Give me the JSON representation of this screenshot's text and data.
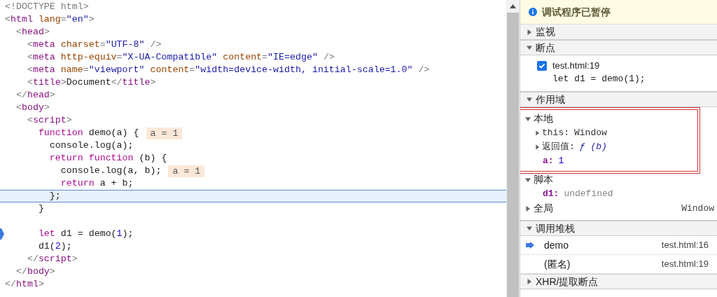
{
  "editor": {
    "lines": [
      {
        "tokens": [
          {
            "kind": "punct",
            "text": "<!DOCTYPE html>"
          }
        ]
      },
      {
        "tokens": [
          {
            "kind": "punct",
            "text": "<"
          },
          {
            "kind": "tag",
            "text": "html"
          },
          {
            "kind": "attr",
            "text": " lang"
          },
          {
            "kind": "punct",
            "text": "="
          },
          {
            "kind": "value",
            "text": "\"en\""
          },
          {
            "kind": "punct",
            "text": ">"
          }
        ]
      },
      {
        "tokens": [
          {
            "kind": "punct",
            "text": "  <"
          },
          {
            "kind": "tag",
            "text": "head"
          },
          {
            "kind": "punct",
            "text": ">"
          }
        ]
      },
      {
        "tokens": [
          {
            "kind": "punct",
            "text": "    <"
          },
          {
            "kind": "tag",
            "text": "meta"
          },
          {
            "kind": "attr",
            "text": " charset"
          },
          {
            "kind": "punct",
            "text": "="
          },
          {
            "kind": "value",
            "text": "\"UTF-8\""
          },
          {
            "kind": "punct",
            "text": " />"
          }
        ]
      },
      {
        "tokens": [
          {
            "kind": "punct",
            "text": "    <"
          },
          {
            "kind": "tag",
            "text": "meta"
          },
          {
            "kind": "attr",
            "text": " http-equiv"
          },
          {
            "kind": "punct",
            "text": "="
          },
          {
            "kind": "value",
            "text": "\"X-UA-Compatible\""
          },
          {
            "kind": "attr",
            "text": " content"
          },
          {
            "kind": "punct",
            "text": "="
          },
          {
            "kind": "value",
            "text": "\"IE=edge\""
          },
          {
            "kind": "punct",
            "text": " />"
          }
        ]
      },
      {
        "tokens": [
          {
            "kind": "punct",
            "text": "    <"
          },
          {
            "kind": "tag",
            "text": "meta"
          },
          {
            "kind": "attr",
            "text": " name"
          },
          {
            "kind": "punct",
            "text": "="
          },
          {
            "kind": "value",
            "text": "\"viewport\""
          },
          {
            "kind": "attr",
            "text": " content"
          },
          {
            "kind": "punct",
            "text": "="
          },
          {
            "kind": "value",
            "text": "\"width=device-width, initial-scale=1.0\""
          },
          {
            "kind": "punct",
            "text": " />"
          }
        ]
      },
      {
        "tokens": [
          {
            "kind": "punct",
            "text": "    <"
          },
          {
            "kind": "tag",
            "text": "title"
          },
          {
            "kind": "punct",
            "text": ">"
          },
          {
            "kind": "plain",
            "text": "Document"
          },
          {
            "kind": "punct",
            "text": "</"
          },
          {
            "kind": "tag",
            "text": "title"
          },
          {
            "kind": "punct",
            "text": ">"
          }
        ]
      },
      {
        "tokens": [
          {
            "kind": "punct",
            "text": "  </"
          },
          {
            "kind": "tag",
            "text": "head"
          },
          {
            "kind": "punct",
            "text": ">"
          }
        ]
      },
      {
        "tokens": [
          {
            "kind": "punct",
            "text": "  <"
          },
          {
            "kind": "tag",
            "text": "body"
          },
          {
            "kind": "punct",
            "text": ">"
          }
        ]
      },
      {
        "tokens": [
          {
            "kind": "punct",
            "text": "    <"
          },
          {
            "kind": "tag",
            "text": "script"
          },
          {
            "kind": "punct",
            "text": ">"
          }
        ]
      },
      {
        "tokens": [
          {
            "kind": "keyword",
            "text": "      function"
          },
          {
            "kind": "plain",
            "text": " demo(a) {"
          }
        ],
        "inline_value": "a = 1"
      },
      {
        "tokens": [
          {
            "kind": "plain",
            "text": "        console.log(a);"
          }
        ]
      },
      {
        "tokens": [
          {
            "kind": "keyword",
            "text": "        return function"
          },
          {
            "kind": "plain",
            "text": " (b) {"
          }
        ]
      },
      {
        "tokens": [
          {
            "kind": "plain",
            "text": "          console.log(a, b);"
          }
        ],
        "inline_value": "a = 1"
      },
      {
        "tokens": [
          {
            "kind": "keyword",
            "text": "          return"
          },
          {
            "kind": "plain",
            "text": " a + b;"
          }
        ]
      },
      {
        "tokens": [
          {
            "kind": "plain",
            "text": "        };"
          }
        ],
        "current": true
      },
      {
        "tokens": [
          {
            "kind": "plain",
            "text": "      }"
          }
        ]
      },
      {
        "tokens": [
          {
            "kind": "keyword",
            "text": "      let"
          },
          {
            "kind": "plain",
            "text": " d1 = demo("
          },
          {
            "kind": "number",
            "text": "1"
          },
          {
            "kind": "plain",
            "text": ");"
          }
        ],
        "breakpoint": true,
        "blank_line_before": true
      },
      {
        "tokens": [
          {
            "kind": "plain",
            "text": "      d1("
          },
          {
            "kind": "number",
            "text": "2"
          },
          {
            "kind": "plain",
            "text": ");"
          }
        ]
      },
      {
        "tokens": [
          {
            "kind": "punct",
            "text": "    </"
          },
          {
            "kind": "tag",
            "text": "script"
          },
          {
            "kind": "punct",
            "text": ">"
          }
        ]
      },
      {
        "tokens": [
          {
            "kind": "punct",
            "text": "  </"
          },
          {
            "kind": "tag",
            "text": "body"
          },
          {
            "kind": "punct",
            "text": ">"
          }
        ]
      },
      {
        "tokens": [
          {
            "kind": "punct",
            "text": "</"
          },
          {
            "kind": "tag",
            "text": "html"
          },
          {
            "kind": "punct",
            "text": ">"
          }
        ]
      }
    ]
  },
  "debugger": {
    "paused_banner": "调试程序已暂停",
    "sections": [
      {
        "title": "监视",
        "expanded": false
      },
      {
        "kind": "breakpoints",
        "title": "断点",
        "expanded": true,
        "items": [
          {
            "file": "test.html:19",
            "code": "let d1 = demo(1);",
            "checked": true
          }
        ]
      },
      {
        "kind": "scope",
        "title": "作用域",
        "expanded": true,
        "groups": [
          {
            "title": "本地",
            "expanded": true,
            "highlighted": true,
            "entries": [
              {
                "name": "this:",
                "value": "Window",
                "kind": "object",
                "expandable": true
              },
              {
                "name": "返回值:",
                "value": "ƒ (b)",
                "kind": "function",
                "expandable": true
              },
              {
                "name": "a:",
                "value": "1",
                "kind": "number",
                "expandable": false
              }
            ]
          },
          {
            "title": "脚本",
            "expanded": true,
            "highlighted": false,
            "entries": [
              {
                "name": "d1:",
                "value": "undefined",
                "kind": "undefined",
                "expandable": false
              }
            ]
          },
          {
            "title": "全局",
            "expanded": false,
            "highlighted": false,
            "value": "Window"
          }
        ]
      },
      {
        "kind": "callstack",
        "title": "调用堆栈",
        "expanded": true,
        "frames": [
          {
            "name": "demo",
            "location": "test.html:16",
            "current": true
          },
          {
            "name": "(匿名)",
            "location": "test.html:19",
            "current": false
          }
        ]
      },
      {
        "title": "XHR/提取断点",
        "expanded": false
      }
    ]
  }
}
